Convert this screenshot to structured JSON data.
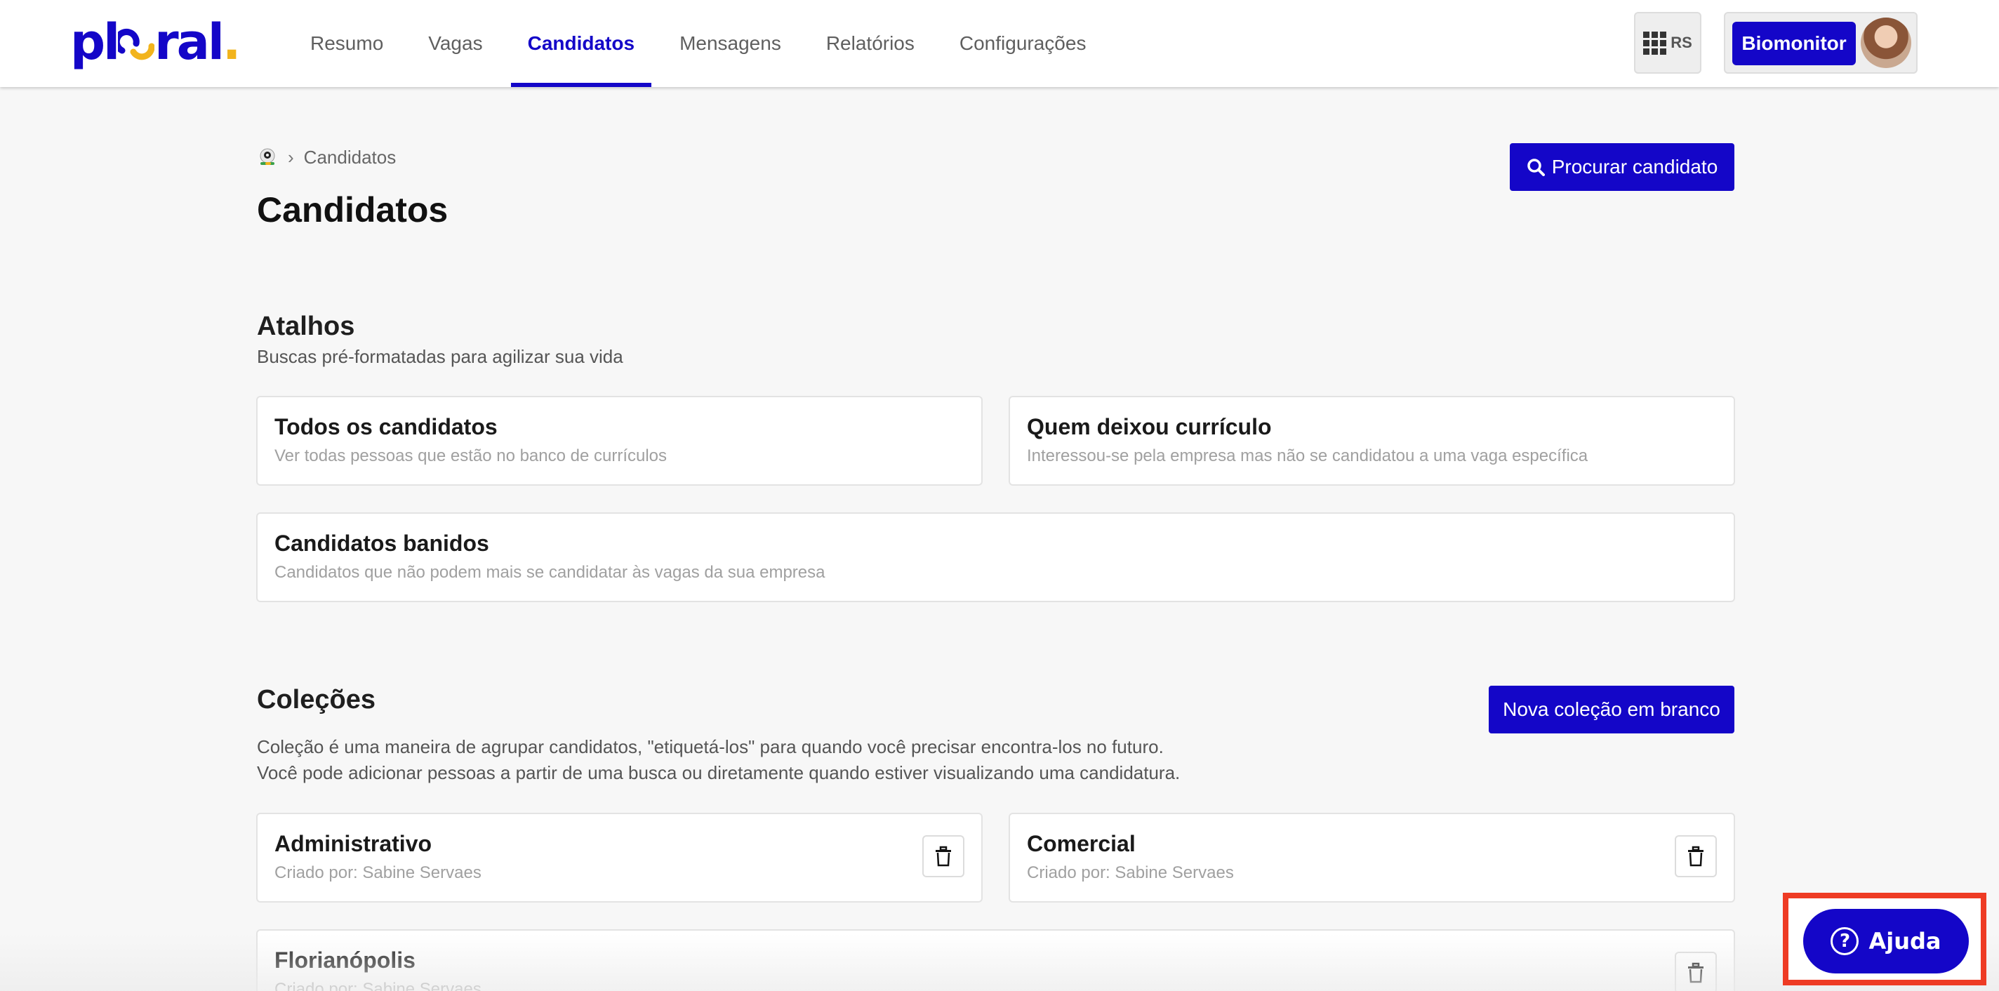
{
  "brand": {
    "logo_text_left": "pl",
    "logo_text_right": "ral",
    "logo_dot": ".",
    "primary_color": "#1406c8",
    "accent_color": "#f2b41c"
  },
  "nav": {
    "items": [
      {
        "label": "Resumo"
      },
      {
        "label": "Vagas"
      },
      {
        "label": "Candidatos",
        "active": true
      },
      {
        "label": "Mensagens"
      },
      {
        "label": "Relatórios"
      },
      {
        "label": "Configurações"
      }
    ]
  },
  "header": {
    "apps_label": "RS",
    "apps_icon": "grid-icon",
    "company_name": "Biomonitor"
  },
  "breadcrumb": {
    "home_icon": "company-logo-icon",
    "current": "Candidatos"
  },
  "page": {
    "title": "Candidatos",
    "search_button_label": "Procurar candidato"
  },
  "shortcuts": {
    "title": "Atalhos",
    "description": "Buscas pré-formatadas para agilizar sua vida",
    "items": [
      {
        "title": "Todos os candidatos",
        "subtitle": "Ver todas pessoas que estão no banco de currículos"
      },
      {
        "title": "Quem deixou currículo",
        "subtitle": "Interessou-se pela empresa mas não se candidatou a uma vaga específica"
      },
      {
        "title": "Candidatos banidos",
        "subtitle": "Candidatos que não podem mais se candidatar às vagas da sua empresa"
      }
    ]
  },
  "collections": {
    "title": "Coleções",
    "new_button_label": "Nova coleção em branco",
    "description_line1": "Coleção é uma maneira de agrupar candidatos, \"etiquetá-los\" para quando você precisar encontra-los no futuro.",
    "description_line2": "Você pode adicionar pessoas a partir de uma busca ou diretamente quando estiver visualizando uma candidatura.",
    "items": [
      {
        "name": "Administrativo",
        "created_by": "Criado por: Sabine Servaes"
      },
      {
        "name": "Comercial",
        "created_by": "Criado por: Sabine Servaes"
      },
      {
        "name": "Florianópolis",
        "created_by": "Criado por: Sabine Servaes"
      }
    ]
  },
  "help": {
    "label": "Ajuda",
    "icon": "question-circle-icon",
    "highlight_color": "#ee3b24"
  }
}
